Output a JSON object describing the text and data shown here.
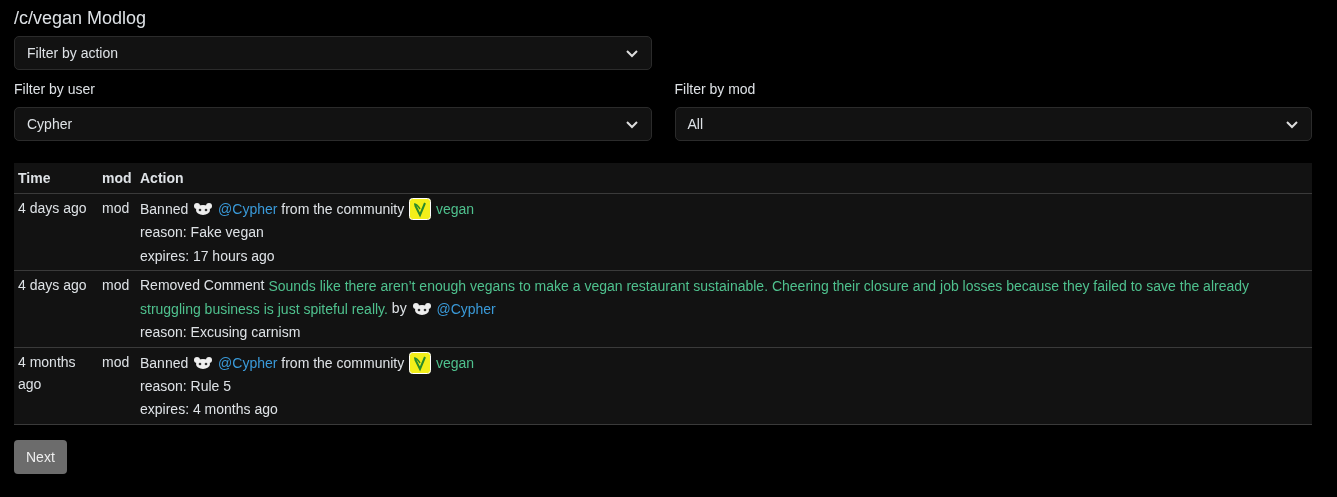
{
  "title": "/c/vegan Modlog",
  "action_filter": {
    "value": "Filter by action"
  },
  "user_filter": {
    "label": "Filter by user",
    "value": "Cypher"
  },
  "mod_filter": {
    "label": "Filter by mod",
    "value": "All"
  },
  "table": {
    "columns": [
      "Time",
      "mod",
      "Action"
    ],
    "rows": [
      {
        "kind": "ban",
        "time": "4 days ago",
        "mod": "mod",
        "verb": "Banned",
        "user": "@Cypher",
        "middle": "from the community",
        "community": "vegan",
        "reason": "reason: Fake vegan",
        "expires": "expires: 17 hours ago"
      },
      {
        "kind": "remove_comment",
        "time": "4 days ago",
        "mod": "mod",
        "verb": "Removed Comment",
        "comment": "Sounds like there aren’t enough vegans to make a vegan restaurant sustainable. Cheering their closure and job losses because they failed to save the already struggling business is just spiteful really.",
        "by": "by",
        "author": "@Cypher",
        "reason": "reason: Excusing carnism"
      },
      {
        "kind": "ban",
        "time": "4 months ago",
        "mod": "mod",
        "verb": "Banned",
        "user": "@Cypher",
        "middle": "from the community",
        "community": "vegan",
        "reason": "reason: Rule 5",
        "expires": "expires: 4 months ago"
      }
    ]
  },
  "next_button": "Next"
}
